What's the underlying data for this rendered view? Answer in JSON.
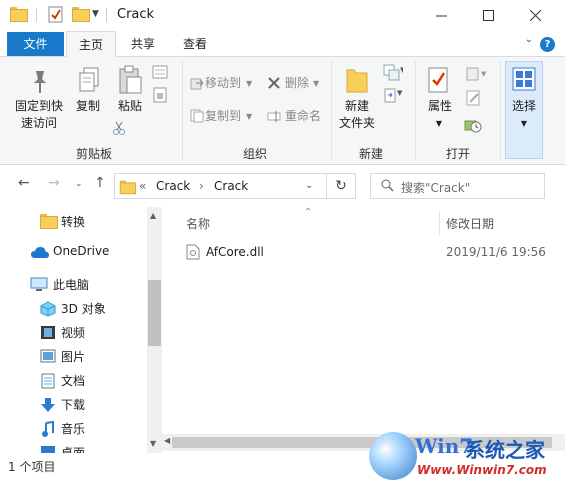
{
  "window": {
    "title": "Crack",
    "minimize": "—",
    "maximize": "☐",
    "close": "✕"
  },
  "tabs": {
    "file": "文件",
    "home": "主页",
    "share": "共享",
    "view": "查看",
    "help": "?"
  },
  "ribbon": {
    "pin": "固定到快\n速访问",
    "pin_l1": "固定到快",
    "pin_l2": "速访问",
    "copy": "复制",
    "paste": "粘贴",
    "clipboard_group": "剪贴板",
    "move_to": "移动到",
    "copy_to": "复制到",
    "delete": "删除",
    "rename": "重命名",
    "organize_group": "组织",
    "new_folder_l1": "新建",
    "new_folder_l2": "文件夹",
    "new_group": "新建",
    "properties": "属性",
    "open_group": "打开",
    "select": "选择"
  },
  "address": {
    "prefix": "«",
    "crumb1": "Crack",
    "crumb2": "Crack",
    "search_placeholder": "搜索\"Crack\""
  },
  "nav": {
    "items": [
      {
        "label": "转换",
        "icon": "folder-icon"
      },
      {
        "label": "OneDrive",
        "icon": "cloud-icon"
      },
      {
        "label": "此电脑",
        "icon": "computer-icon"
      },
      {
        "label": "3D 对象",
        "icon": "cube-icon"
      },
      {
        "label": "视频",
        "icon": "video-icon"
      },
      {
        "label": "图片",
        "icon": "picture-icon"
      },
      {
        "label": "文档",
        "icon": "document-icon"
      },
      {
        "label": "下载",
        "icon": "download-icon"
      },
      {
        "label": "音乐",
        "icon": "music-icon"
      },
      {
        "label": "桌面",
        "icon": "desktop-icon"
      }
    ]
  },
  "columns": {
    "name": "名称",
    "modified": "修改日期"
  },
  "files": [
    {
      "name": "AfCore.dll",
      "modified": "2019/11/6 19:56"
    }
  ],
  "status": {
    "count": "1 个项目"
  },
  "watermark": {
    "brand": "Win7",
    "cn": "系统之家",
    "url": "Www.Winwin7.com"
  },
  "colors": {
    "accent": "#1979ca",
    "folder": "#f7cf5a"
  }
}
